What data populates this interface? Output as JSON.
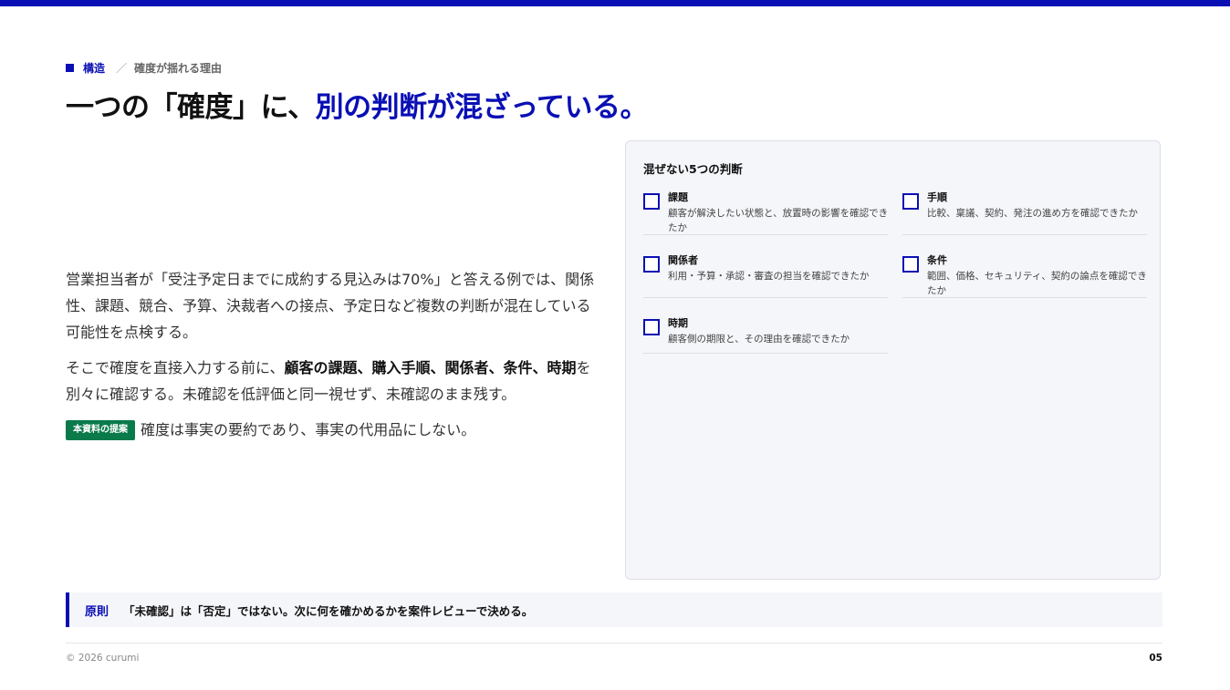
{
  "breadcrumb": {
    "main": "構造",
    "separator": "／",
    "sub": "確度が揺れる理由"
  },
  "title": {
    "plain": "一つの「確度」に、",
    "accent": "別の判断が混ざっている。"
  },
  "body": {
    "paragraph1": "営業担当者が「受注予定日までに成約する見込みは70%」と答える例では、関係性、課題、競合、予算、決裁者への接点、予定日など複数の判断が混在している可能性を点検する。",
    "paragraph2_before": "そこで確度を直接入力する前に、",
    "paragraph2_bold": "顧客の課題、購入手順、関係者、条件、時期",
    "paragraph2_after": "を別々に確認する。未確認を低評価と同一視せず、未確認のまま残す。",
    "proposal_badge": "本資料の提案",
    "proposal_text": "確度は事実の要約であり、事実の代用品にしない。"
  },
  "checklist": {
    "title": "混ぜない5つの判断",
    "items": [
      {
        "title": "課題",
        "desc": "顧客が解決したい状態と、放置時の影響を確認できたか"
      },
      {
        "title": "手順",
        "desc": "比較、稟議、契約、発注の進め方を確認できたか"
      },
      {
        "title": "関係者",
        "desc": "利用・予算・承認・審査の担当を確認できたか"
      },
      {
        "title": "条件",
        "desc": "範囲、価格、セキュリティ、契約の論点を確認できたか"
      },
      {
        "title": "時期",
        "desc": "顧客側の期限と、その理由を確認できたか"
      }
    ]
  },
  "principle": {
    "label": "原則",
    "text": "「未確認」は「否定」ではない。次に何を確かめるかを案件レビューで決める。"
  },
  "footer": {
    "copyright": "© 2026 curumi",
    "page": "05"
  },
  "colors": {
    "accent": "#0a0fb4",
    "badge_green": "#0b7a4b",
    "card_bg": "#f5f6fa"
  }
}
